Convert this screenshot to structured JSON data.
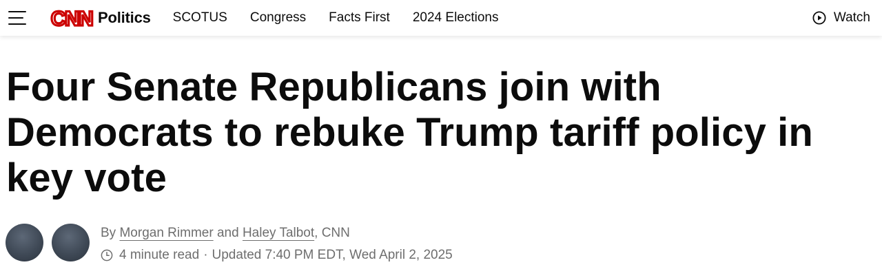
{
  "header": {
    "menu_icon": "hamburger-menu-icon",
    "logo_text": "CNN",
    "logo_color": "#cc0000",
    "section": "Politics",
    "nav": [
      "SCOTUS",
      "Congress",
      "Facts First",
      "2024 Elections"
    ],
    "watch_label": "Watch",
    "watch_icon": "play-circle-icon"
  },
  "article": {
    "headline": "Four Senate Republicans join with Democrats to rebuke Trump tariff policy in key vote",
    "byline": {
      "prefix": "By",
      "author1": "Morgan Rimmer",
      "conjunction": "and",
      "author2": "Haley Talbot",
      "suffix": ", CNN"
    },
    "read_time": "4 minute read",
    "separator": "·",
    "updated": "Updated 7:40 PM EDT, Wed April 2, 2025",
    "clock_icon": "clock-icon"
  },
  "colors": {
    "text": "#0c0c0c",
    "meta": "#6e6e6e",
    "brand_red": "#cc0000"
  }
}
